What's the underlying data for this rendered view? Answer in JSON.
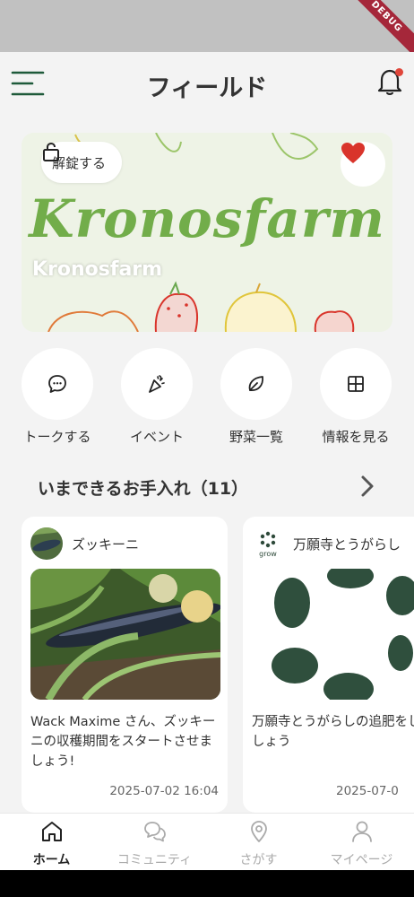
{
  "status_bar": {
    "debug_label": "DEBUG"
  },
  "header": {
    "title": "フィールド",
    "menu_icon": "hamburger-icon",
    "notification_icon": "bell-icon",
    "accent": "#1e5a3a"
  },
  "banner": {
    "logo_text": "Kronosfarm",
    "caption": "Kronosfarm",
    "unlock_label": "解錠する",
    "unlock_icon": "lock-icon",
    "favorite_icon": "heart-icon",
    "favorite_color": "#d9342b"
  },
  "actions": [
    {
      "label": "トークする",
      "icon": "chat-bubble-icon"
    },
    {
      "label": "イベント",
      "icon": "party-popper-icon"
    },
    {
      "label": "野菜一覧",
      "icon": "leaf-icon"
    },
    {
      "label": "情報を見る",
      "icon": "grid-icon"
    }
  ],
  "section": {
    "title": "いまできるお手入れ（11）",
    "arrow_icon": "chevron-right-icon"
  },
  "cards": [
    {
      "name": "ズッキーニ",
      "text": "Wack Maxime さん、ズッキーニの収穫期間をスタートさせましょう!",
      "date": "2025-07-02 16:04"
    },
    {
      "name": "万願寺とうがらし",
      "avatar_text": "grow",
      "text": "万願寺とうがらしの追肥をしましょう",
      "date": "2025-07-0"
    }
  ],
  "bottom_nav": [
    {
      "label": "ホーム",
      "icon": "home-icon",
      "active": true
    },
    {
      "label": "コミュニティ",
      "icon": "community-icon",
      "active": false
    },
    {
      "label": "さがす",
      "icon": "location-pin-icon",
      "active": false
    },
    {
      "label": "マイページ",
      "icon": "person-icon",
      "active": false
    }
  ]
}
